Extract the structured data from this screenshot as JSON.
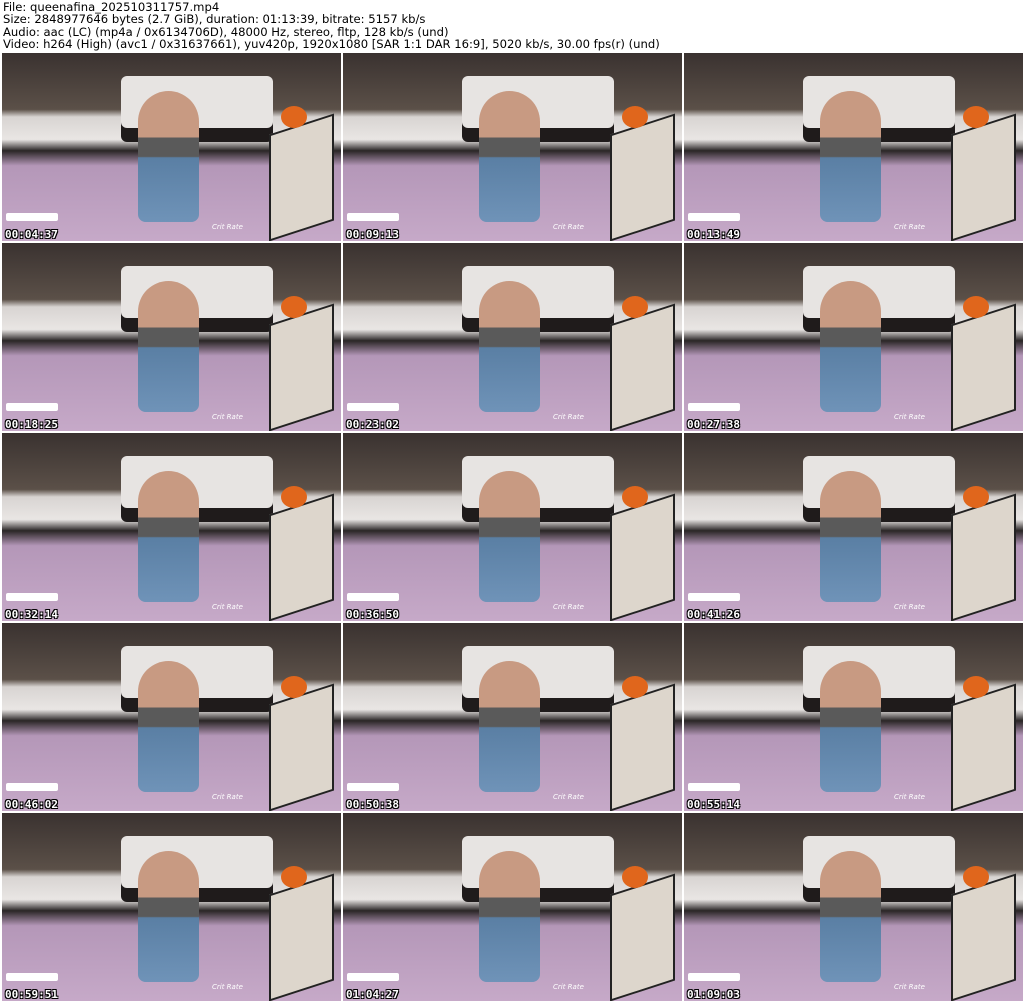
{
  "header": {
    "file": "File: queenafina_202510311757.mp4",
    "size": "Size: 2848977646 bytes (2.7 GiB), duration: 01:13:39, bitrate: 5157 kb/s",
    "audio": "Audio: aac (LC) (mp4a / 0x6134706D), 48000 Hz, stereo, fltp, 128 kb/s (und)",
    "video": "Video: h264 (High) (avc1 / 0x31637661), yuv420p, 1920x1080 [SAR 1:1 DAR 16:9], 5020 kb/s, 30.00 fps(r) (und)"
  },
  "overlay_label": "Crit Rate",
  "thumbnails": [
    {
      "timestamp": "00:04:37"
    },
    {
      "timestamp": "00:09:13"
    },
    {
      "timestamp": "00:13:49"
    },
    {
      "timestamp": "00:18:25"
    },
    {
      "timestamp": "00:23:02"
    },
    {
      "timestamp": "00:27:38"
    },
    {
      "timestamp": "00:32:14"
    },
    {
      "timestamp": "00:36:50"
    },
    {
      "timestamp": "00:41:26"
    },
    {
      "timestamp": "00:46:02"
    },
    {
      "timestamp": "00:50:38"
    },
    {
      "timestamp": "00:55:14"
    },
    {
      "timestamp": "00:59:51"
    },
    {
      "timestamp": "01:04:27"
    },
    {
      "timestamp": "01:09:03"
    }
  ]
}
